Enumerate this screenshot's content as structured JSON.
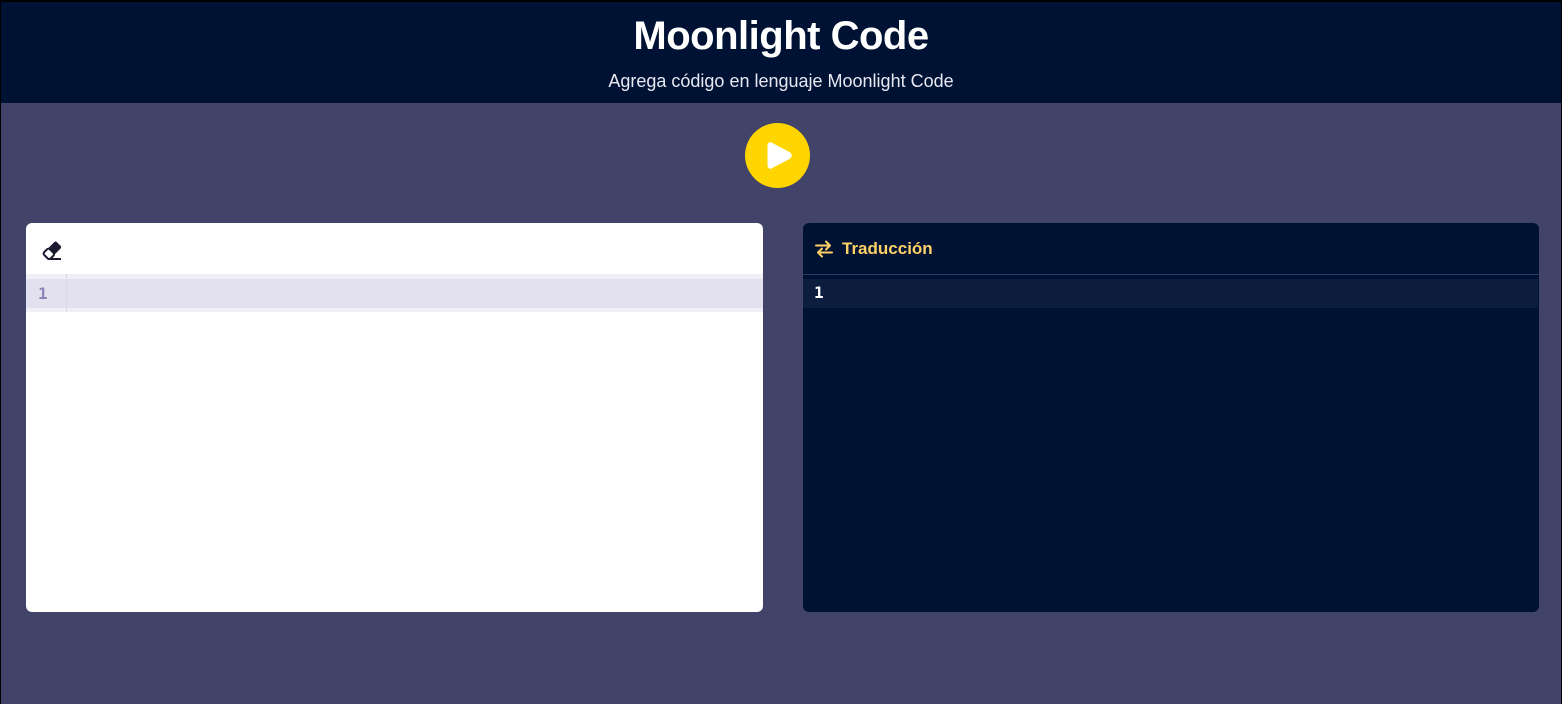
{
  "header": {
    "title": "Moonlight Code",
    "subtitle": "Agrega código en lenguaje Moonlight Code"
  },
  "run_button": {
    "icon": "play-icon",
    "color": "#ffd500"
  },
  "editor": {
    "toolbar_icon": "eraser-icon",
    "line_numbers": [
      "1"
    ],
    "content": ""
  },
  "translation": {
    "icon": "swap-arrows-icon",
    "label": "Traducción",
    "label_color": "#ffd166",
    "line_numbers": [
      "1"
    ],
    "content": ""
  },
  "colors": {
    "page_bg": "#424368",
    "header_bg": "#001233",
    "accent": "#ffd500"
  }
}
